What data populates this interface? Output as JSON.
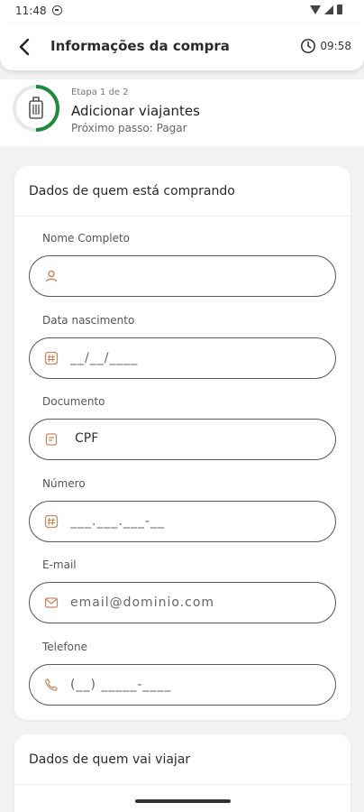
{
  "status_bar": {
    "time": "11:48"
  },
  "header": {
    "title": "Informações da compra",
    "timer": "09:58"
  },
  "progress": {
    "step_label": "Etapa 1 de 2",
    "step_title": "Adicionar viajantes",
    "next_step": "Próximo passo: Pagar",
    "current": 1,
    "total": 2
  },
  "buyer_section": {
    "title": "Dados de quem está comprando",
    "fields": {
      "full_name": {
        "label": "Nome Completo",
        "placeholder": "",
        "icon": "person-icon"
      },
      "birth_date": {
        "label": "Data nascimento",
        "placeholder": "__/__/____",
        "icon": "hash-icon"
      },
      "document": {
        "label": "Documento",
        "value": "CPF",
        "icon": "document-icon"
      },
      "number": {
        "label": "Número",
        "placeholder": "___.___.___-__",
        "icon": "hash-icon"
      },
      "email": {
        "label": "E-mail",
        "placeholder": "email@dominio.com",
        "icon": "mail-icon"
      },
      "phone": {
        "label": "Telefone",
        "placeholder": "(__) _____-____",
        "icon": "phone-icon"
      }
    }
  },
  "traveler_section": {
    "title": "Dados de quem vai viajar"
  },
  "colors": {
    "accent": "#c9885a",
    "progress": "#1f8a3c",
    "border": "#5a5a5a"
  }
}
